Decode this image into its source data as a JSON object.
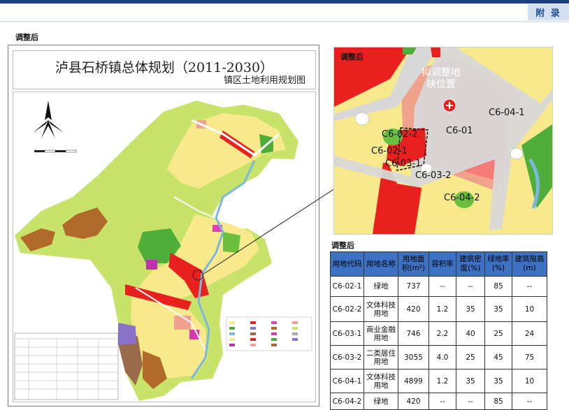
{
  "header": {
    "appendix_label": "附 录"
  },
  "left_label": "调整后",
  "map": {
    "title": "泸县石桥镇总体规划（2011-2030）",
    "subtitle": "镇区土地利用规划图"
  },
  "detail": {
    "label": "调整后",
    "site_label_line1": "拟调整地",
    "site_label_line2": "块位置",
    "parcels": [
      "C6-04-1",
      "C6-01",
      "C6-02-2",
      "C6-02-1",
      "C6-03-1",
      "C6-03-2",
      "C6-04-2"
    ]
  },
  "table": {
    "label": "调整后",
    "headers": [
      "用地代码",
      "用地名称",
      "用地面积(m²)",
      "容积率",
      "建筑密度(%)",
      "绿地率(%)",
      "建筑限高(m)"
    ],
    "rows": [
      [
        "C6-02-1",
        "绿地",
        "737",
        "--",
        "--",
        "85",
        "--"
      ],
      [
        "C6-02-2",
        "文体科技用地",
        "420",
        "1.2",
        "35",
        "35",
        "10"
      ],
      [
        "C6-03-1",
        "商业金融用地",
        "746",
        "2.2",
        "40",
        "25",
        "24"
      ],
      [
        "C6-03-2",
        "二类居住用地",
        "3055",
        "4.0",
        "25",
        "45",
        "75"
      ],
      [
        "C6-04-1",
        "文体科技用地",
        "4899",
        "1.2",
        "35",
        "35",
        "10"
      ],
      [
        "C6-04-2",
        "绿地",
        "420",
        "--",
        "--",
        "85",
        "--"
      ]
    ]
  }
}
